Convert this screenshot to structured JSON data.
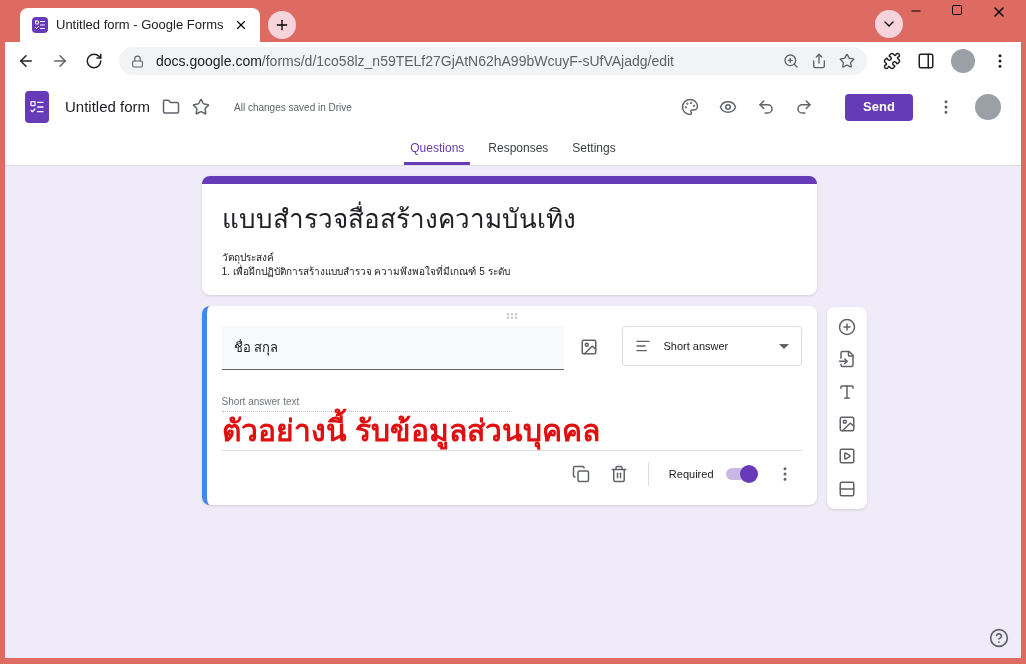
{
  "browser": {
    "tab_title": "Untitled form - Google Forms",
    "url_host": "docs.google.com",
    "url_path": "/forms/d/1co58lz_n59TELf27GjAtN62hA99bWcuyF-sUfVAjadg/edit"
  },
  "header": {
    "form_name": "Untitled form",
    "save_status": "All changes saved in Drive",
    "send_button": "Send"
  },
  "tabs": [
    {
      "label": "Questions",
      "selected": true
    },
    {
      "label": "Responses",
      "selected": false
    },
    {
      "label": "Settings",
      "selected": false
    }
  ],
  "form": {
    "title": "แบบสำรวจสื่อสร้างความบันเทิง",
    "description_lines": [
      "วัตถุประสงค์",
      "1. เพื่อฝึกปฏิบัติการสร้างแบบสำรวจ ความพึงพอใจที่มีเกณฑ์ 5 ระดับ"
    ]
  },
  "question": {
    "title": "ชื่อ สกุล",
    "type": "Short answer",
    "answer_placeholder": "Short answer text",
    "required_label": "Required",
    "required": true
  },
  "annotation": "ตัวอย่างนี้ รับข้อมูลส่วนบุคคล"
}
